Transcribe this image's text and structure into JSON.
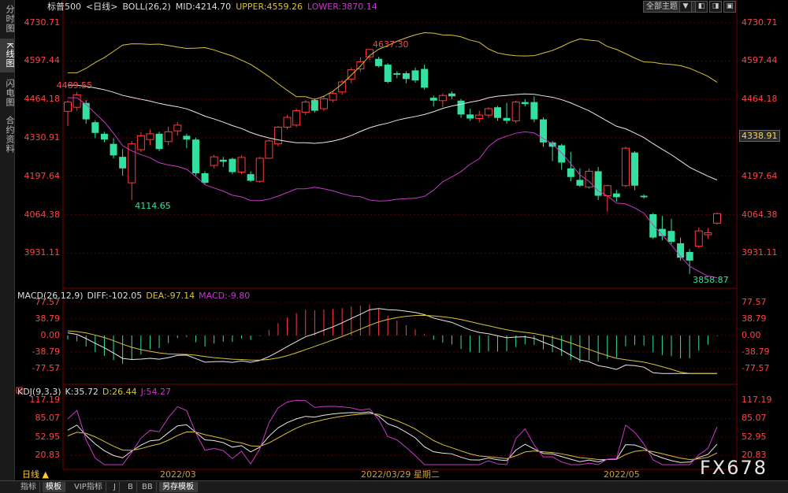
{
  "sidebar": {
    "tabs": [
      {
        "label": "分时图",
        "active": false
      },
      {
        "label": "K线图",
        "active": true
      },
      {
        "label": "闪电图",
        "active": false
      },
      {
        "label": "合约资料",
        "active": false
      }
    ]
  },
  "header": {
    "symbol": "标普500",
    "period": "<日线>",
    "boll": "BOLL(26,2)",
    "mid": "MID:4214.70",
    "upper": "UPPER:4559.26",
    "lower": "LOWER:3870.14",
    "theme_select": "全部主题",
    "toolbar_buttons": [
      "▼",
      "◧",
      "◨",
      "▣"
    ]
  },
  "colors": {
    "up": "#ff3b3b",
    "down": "#33e0a0",
    "boll_mid": "#e8e8e8",
    "boll_upper": "#d8c23a",
    "boll_lower": "#c838c8",
    "price_label": "#ff4444",
    "grid": "#5a0000",
    "diff": "#e8e8e8",
    "dea": "#d8c23a",
    "macd": "#c838c8"
  },
  "price_axis": {
    "ticks": [
      "4730.71",
      "4597.44",
      "4464.18",
      "4330.91",
      "4197.64",
      "4064.38",
      "3931.11"
    ],
    "current_price": "4338.91"
  },
  "annotations": {
    "high_1": "4489.55",
    "low_1": "4114.65",
    "high_2": "4637.30",
    "low_2": "3858.87"
  },
  "macd": {
    "title": "MACD(26,12,9)",
    "diff": "DIFF:-102.05",
    "dea": "DEA:-97.14",
    "macd": "MACD:-9.80",
    "ticks": [
      "77.57",
      "38.79",
      "0.00",
      "-38.79",
      "-77.57"
    ]
  },
  "kdj": {
    "title": "KDJ(9,3,3)",
    "k": "K:35.72",
    "d": "D:26.44",
    "j": "J:54.27",
    "ticks": [
      "117.19",
      "85.07",
      "52.95",
      "20.83"
    ]
  },
  "x_axis": {
    "labels": [
      "2022/03",
      "2022/03/29 星期二",
      "2022/05"
    ]
  },
  "bottom_bar": {
    "period": "日线 ▲",
    "tabs": [
      {
        "label": "指标",
        "active": false
      },
      {
        "label": "模板",
        "active": true
      },
      {
        "label": "VIP指标",
        "active": false
      },
      {
        "label": "J",
        "active": false
      },
      {
        "label": "B",
        "active": false
      },
      {
        "label": "BB",
        "active": false
      },
      {
        "label": "另存模板",
        "active": true
      }
    ]
  },
  "watermark": "FX678",
  "chart_data": {
    "type": "candlestick",
    "candles_ohlc": [
      [
        4423,
        4455,
        4372,
        4460
      ],
      [
        4437,
        4480,
        4425,
        4489.55
      ],
      [
        4452,
        4395,
        4380,
        4462
      ],
      [
        4385,
        4348,
        4330,
        4392
      ],
      [
        4345,
        4325,
        4315,
        4352
      ],
      [
        4310,
        4270,
        4260,
        4330
      ],
      [
        4265,
        4225,
        4200,
        4292
      ],
      [
        4175,
        4310,
        4114.65,
        4320
      ],
      [
        4290,
        4338,
        4282,
        4350
      ],
      [
        4325,
        4345,
        4305,
        4360
      ],
      [
        4345,
        4292,
        4285,
        4352
      ],
      [
        4318,
        4352,
        4305,
        4370
      ],
      [
        4355,
        4375,
        4338,
        4385
      ],
      [
        4338,
        4325,
        4295,
        4345
      ],
      [
        4325,
        4208,
        4200,
        4332
      ],
      [
        4208,
        4175,
        4170,
        4215
      ],
      [
        4235,
        4265,
        4225,
        4272
      ],
      [
        4255,
        4248,
        4230,
        4265
      ],
      [
        4258,
        4212,
        4205,
        4262
      ],
      [
        4212,
        4263,
        4205,
        4270
      ],
      [
        4205,
        4182,
        4178,
        4215
      ],
      [
        4180,
        4260,
        4175,
        4265
      ],
      [
        4260,
        4320,
        4258,
        4325
      ],
      [
        4310,
        4368,
        4302,
        4372
      ],
      [
        4368,
        4402,
        4360,
        4410
      ],
      [
        4375,
        4425,
        4368,
        4432
      ],
      [
        4420,
        4455,
        4410,
        4462
      ],
      [
        4462,
        4425,
        4418,
        4468
      ],
      [
        4432,
        4466,
        4425,
        4475
      ],
      [
        4462,
        4485,
        4455,
        4492
      ],
      [
        4490,
        4525,
        4480,
        4532
      ],
      [
        4535,
        4567,
        4520,
        4575
      ],
      [
        4570,
        4595,
        4560,
        4610
      ],
      [
        4612,
        4637.3,
        4600,
        4637.3
      ],
      [
        4605,
        4580,
        4575,
        4612
      ],
      [
        4585,
        4525,
        4520,
        4590
      ],
      [
        4555,
        4550,
        4538,
        4562
      ],
      [
        4555,
        4535,
        4520,
        4562
      ],
      [
        4565,
        4530,
        4522,
        4575
      ],
      [
        4570,
        4505,
        4498,
        4585
      ],
      [
        4470,
        4460,
        4440,
        4478
      ],
      [
        4460,
        4478,
        4438,
        4485
      ],
      [
        4485,
        4475,
        4465,
        4492
      ],
      [
        4460,
        4412,
        4400,
        4466
      ],
      [
        4412,
        4398,
        4390,
        4432
      ],
      [
        4398,
        4410,
        4385,
        4425
      ],
      [
        4410,
        4432,
        4400,
        4437
      ],
      [
        4437,
        4400,
        4390,
        4442
      ],
      [
        4400,
        4390,
        4380,
        4452
      ],
      [
        4390,
        4455,
        4382,
        4460
      ],
      [
        4455,
        4448,
        4440,
        4465
      ],
      [
        4455,
        4395,
        4385,
        4475
      ],
      [
        4395,
        4315,
        4300,
        4402
      ],
      [
        4315,
        4300,
        4250,
        4320
      ],
      [
        4305,
        4245,
        4220,
        4310
      ],
      [
        4225,
        4195,
        4180,
        4282
      ],
      [
        4185,
        4165,
        4160,
        4225
      ],
      [
        4160,
        4215,
        4155,
        4225
      ],
      [
        4215,
        4130,
        4115,
        4230
      ],
      [
        4130,
        4165,
        4075,
        4168
      ],
      [
        4138,
        4125,
        4110,
        4150
      ],
      [
        4165,
        4295,
        4160,
        4300
      ],
      [
        4280,
        4165,
        4150,
        4285
      ],
      [
        4130,
        4125,
        4120,
        4135
      ],
      [
        4066,
        3985,
        3980,
        4070
      ],
      [
        4015,
        3990,
        3975,
        4060
      ],
      [
        4008,
        3970,
        3962,
        4050
      ],
      [
        3965,
        3915,
        3905,
        3985
      ],
      [
        3935,
        3905,
        3858.87,
        3945
      ],
      [
        3955,
        4008,
        3948,
        4020
      ],
      [
        3995,
        4002,
        3980,
        4018
      ],
      [
        4035,
        4068,
        4030,
        4072
      ]
    ]
  }
}
